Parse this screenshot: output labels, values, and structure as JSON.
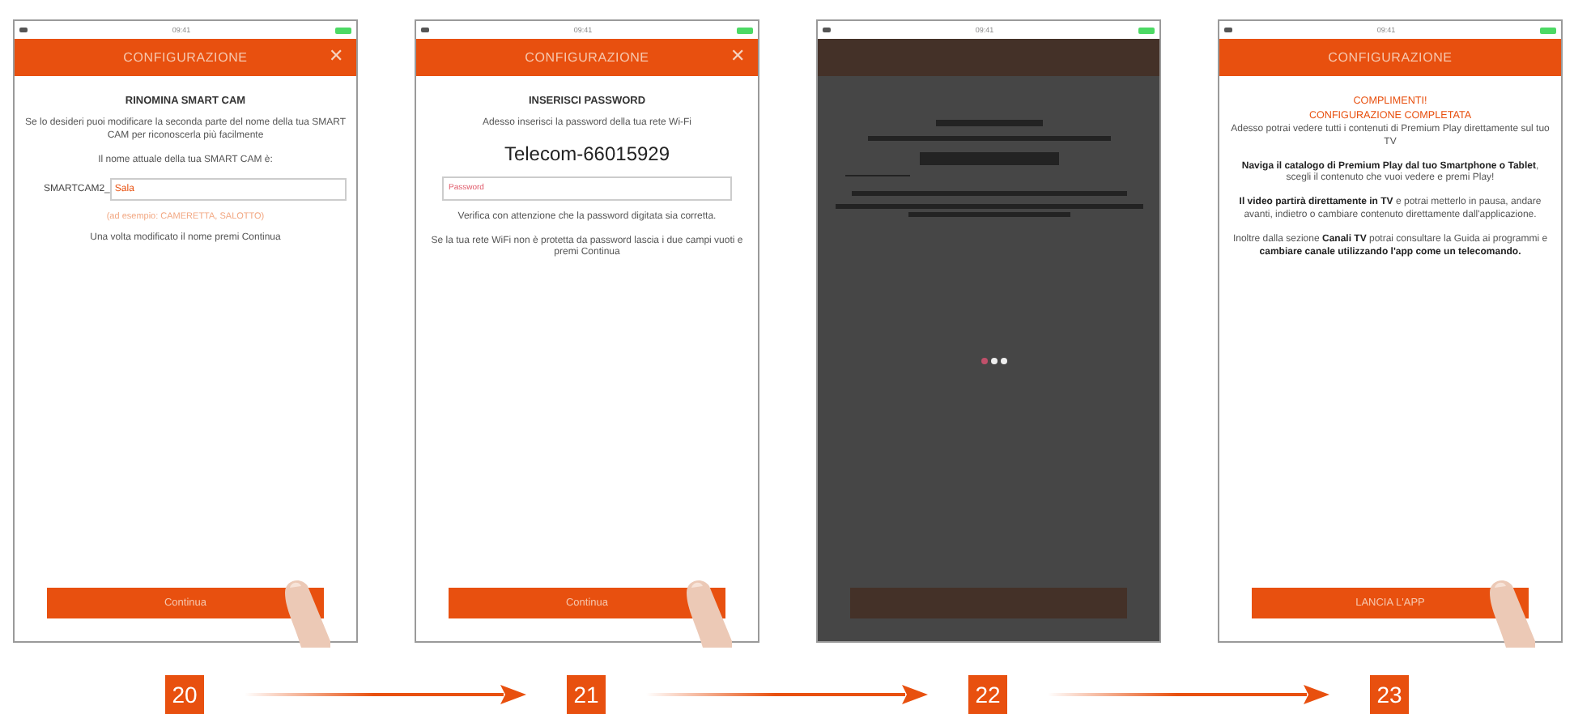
{
  "screens": [
    {
      "status_time": "09:41",
      "header_title": "CONFIGURAZIONE",
      "close_icon": "✕",
      "loading": false,
      "finger": true,
      "button": "Continua",
      "blocks": [
        {
          "kind": "heading",
          "text": "RINOMINA SMART CAM"
        },
        {
          "kind": "text",
          "text": "Se lo desideri puoi modificare la seconda parte del nome della tua SMART CAM per riconoscerla più facilmente"
        },
        {
          "kind": "text",
          "text": "Il nome attuale della tua SMART CAM è:"
        },
        {
          "kind": "name_field",
          "prefix": "SMARTCAM2_",
          "value": "Sala"
        },
        {
          "kind": "note",
          "text": "(ad esempio: CAMERETTA, SALOTTO)"
        },
        {
          "kind": "text",
          "text": "Una volta modificato il nome premi Continua"
        }
      ]
    },
    {
      "status_time": "09:41",
      "header_title": "CONFIGURAZIONE",
      "close_icon": "✕",
      "loading": false,
      "finger": true,
      "button": "Continua",
      "blocks": [
        {
          "kind": "heading",
          "text": "INSERISCI PASSWORD"
        },
        {
          "kind": "text",
          "text": "Adesso inserisci la password della tua rete Wi-Fi"
        },
        {
          "kind": "network",
          "text": "Telecom-66015929"
        },
        {
          "kind": "password_field",
          "placeholder": "Password"
        },
        {
          "kind": "text",
          "text": "Verifica con attenzione che la password digitata sia corretta."
        },
        {
          "kind": "text",
          "text": "Se la tua rete WiFi non è protetta da password lascia i due campi vuoti e premi Continua"
        }
      ]
    },
    {
      "status_time": "09:41",
      "loading": true
    },
    {
      "status_time": "09:41",
      "header_title": "CONFIGURAZIONE",
      "loading": false,
      "finger": true,
      "button": "LANCIA L'APP",
      "blocks": [
        {
          "kind": "success",
          "text": "COMPLIMENTI!"
        },
        {
          "kind": "success",
          "text": "CONFIGURAZIONE COMPLETATA"
        },
        {
          "kind": "text",
          "text": "Adesso potrai vedere tutti i contenuti di Premium Play direttamente sul tuo TV"
        },
        {
          "kind": "text",
          "text": "**Naviga il catalogo di Premium Play dal tuo Smartphone o Tablet**, scegli il contenuto che vuoi vedere e premi Play!"
        },
        {
          "kind": "text",
          "text": "**Il video partirà direttamente in TV** e potrai metterlo in pausa, andare avanti, indietro o cambiare contenuto direttamente dall'applicazione."
        },
        {
          "kind": "text",
          "text": "Inoltre dalla sezione **Canali TV** potrai consultare la Guida ai programmi e **cambiare canale utilizzando l'app come un telecomando.**"
        }
      ]
    }
  ],
  "steps": [
    "20",
    "21",
    "22",
    "23"
  ]
}
